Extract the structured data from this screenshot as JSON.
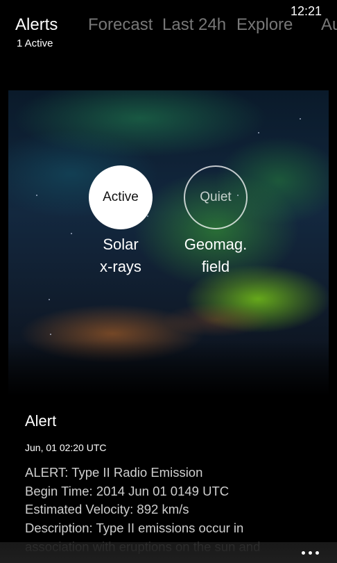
{
  "status_bar": {
    "time": "12:21"
  },
  "pivot": {
    "tabs": [
      {
        "label": "Alerts",
        "active": true
      },
      {
        "label": "Forecast",
        "active": false
      },
      {
        "label": "Last 24h",
        "active": false
      },
      {
        "label": "Explore",
        "active": false
      },
      {
        "label": "Au",
        "active": false
      }
    ],
    "subtitle": "1 Active"
  },
  "indicators": [
    {
      "state": "Active",
      "label_line1": "Solar",
      "label_line2": "x-rays"
    },
    {
      "state": "Quiet",
      "label_line1": "Geomag.",
      "label_line2": "field"
    }
  ],
  "alert": {
    "title": "Alert",
    "date": "Jun, 01 02:20 UTC",
    "lines": [
      "ALERT: Type II Radio Emission",
      "Begin Time: 2014 Jun 01 0149 UTC",
      "Estimated Velocity: 892 km/s",
      "Description: Type II emissions occur in",
      "association with eruptions on the sun and"
    ]
  },
  "app_bar": {
    "more_icon": "ellipsis-icon"
  },
  "colors": {
    "background": "#000000",
    "active_text": "#ffffff",
    "inactive_tab": "#777777",
    "body_text": "#cfcfcf",
    "app_bar": "#1f1f1f"
  }
}
